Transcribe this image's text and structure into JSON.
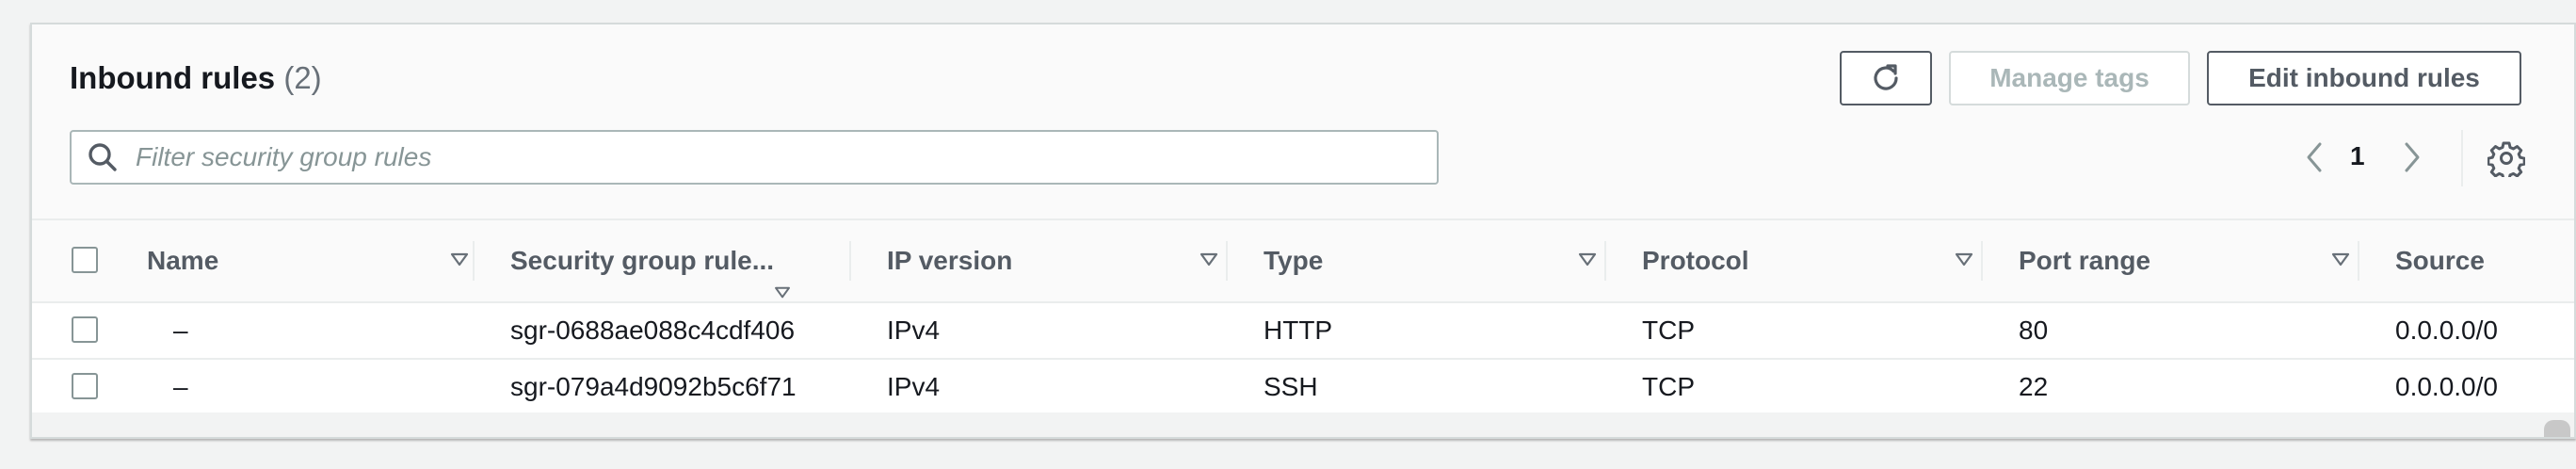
{
  "header": {
    "title": "Inbound rules",
    "count": "(2)"
  },
  "toolbar": {
    "refresh_icon": "refresh-icon",
    "manage_tags_label": "Manage tags",
    "edit_inbound_label": "Edit inbound rules"
  },
  "search": {
    "placeholder": "Filter security group rules",
    "value": "",
    "icon": "search-icon"
  },
  "pagination": {
    "page": "1",
    "prev_icon": "chevron-left-icon",
    "next_icon": "chevron-right-icon",
    "settings_icon": "gear-icon"
  },
  "table": {
    "columns": [
      "Name",
      "Security group rule...",
      "IP version",
      "Type",
      "Protocol",
      "Port range",
      "Source"
    ],
    "rows": [
      {
        "name": "–",
        "rule_id": "sgr-0688ae088c4cdf406",
        "ip_version": "IPv4",
        "type": "HTTP",
        "protocol": "TCP",
        "port_range": "80",
        "source": "0.0.0.0/0"
      },
      {
        "name": "–",
        "rule_id": "sgr-079a4d9092b5c6f71",
        "ip_version": "IPv4",
        "type": "SSH",
        "protocol": "TCP",
        "port_range": "22",
        "source": "0.0.0.0/0"
      }
    ]
  },
  "colors": {
    "panel_bg": "#fafafa",
    "text": "#16191f",
    "muted": "#545b64",
    "disabled": "#aab7b8",
    "border": "#eaeded"
  }
}
